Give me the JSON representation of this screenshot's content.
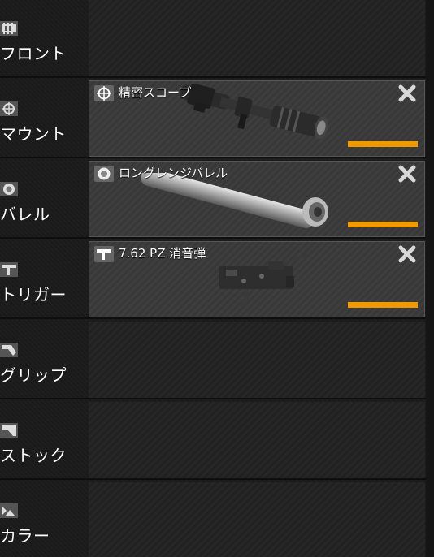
{
  "slots": [
    {
      "name": "フロント",
      "icon": "front-sight-icon"
    },
    {
      "name": "マウント",
      "icon": "mount-crosshair-icon"
    },
    {
      "name": "バレル",
      "icon": "barrel-icon"
    },
    {
      "name": "トリガー",
      "icon": "trigger-icon"
    },
    {
      "name": "グリップ",
      "icon": "grip-icon"
    },
    {
      "name": "ストック",
      "icon": "stock-icon"
    },
    {
      "name": "カラー",
      "icon": "color-icon"
    }
  ],
  "equipped": {
    "mount": {
      "name": "精密スコープ",
      "icon": "crosshair-icon",
      "image": "scope-image"
    },
    "barrel": {
      "name": "ロングレンジバレル",
      "icon": "barrel-icon",
      "image": "barrel-image"
    },
    "trigger": {
      "name": "7.62 PZ 消音弾",
      "icon": "trigger-icon",
      "image": "trigger-image"
    }
  },
  "colors": {
    "accent_bar": "#f09a00",
    "text": "#ffffff",
    "card_bg": "#3a3a3a",
    "slot_bg": "#222222"
  }
}
